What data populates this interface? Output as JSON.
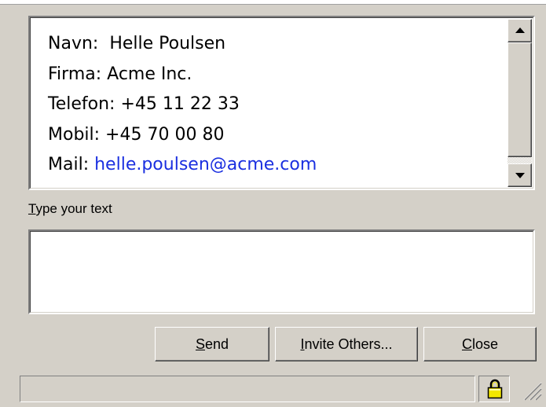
{
  "transcript": {
    "lines": [
      {
        "label": "Navn:",
        "value": "Helle Poulsen"
      },
      {
        "label": "Firma:",
        "value": "Acme Inc."
      },
      {
        "label": "Telefon:",
        "value": "+45 11 22 33"
      },
      {
        "label": "Mobil:",
        "value": "+45 70 00 80"
      },
      {
        "label": "Mail:",
        "value": "helle.poulsen@acme.com"
      }
    ]
  },
  "composer": {
    "label_mnemonic": "T",
    "label_rest": "ype your text",
    "value": "",
    "placeholder": ""
  },
  "buttons": {
    "send": {
      "mnemonic": "S",
      "rest": "end"
    },
    "invite": {
      "mnemonic": "I",
      "rest": "nvite Others..."
    },
    "close": {
      "mnemonic": "C",
      "rest": "lose"
    }
  },
  "statusbar": {
    "text": ""
  },
  "colors": {
    "link": "#1a2fe0",
    "face": "#d4d0c8",
    "lock": "#f2e600"
  },
  "icons": {
    "scroll_up": "triangle-up",
    "scroll_down": "triangle-down",
    "lock": "padlock",
    "grip": "resize-grip"
  }
}
